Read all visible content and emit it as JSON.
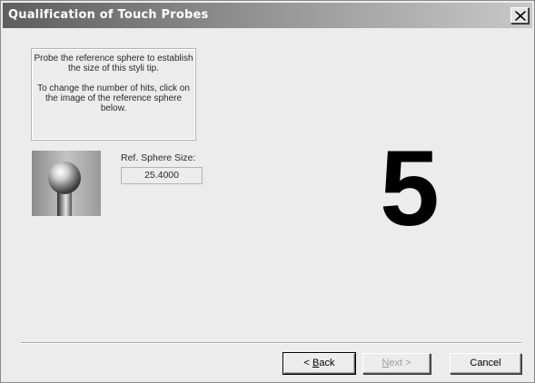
{
  "window": {
    "title": "Qualification of Touch Probes",
    "close_label": "Close"
  },
  "instructions": {
    "line1": "Probe the reference sphere to establish the size of this styli tip.",
    "line2": "To change the number of hits, click on the image of the reference sphere below."
  },
  "reference_sphere": {
    "label": "Ref. Sphere Size:",
    "value": "25.4000"
  },
  "hits_remaining": "5",
  "buttons": {
    "back": "< Back",
    "back_accelerator": "B",
    "next": "Next >",
    "next_accelerator": "N",
    "next_enabled": false,
    "cancel": "Cancel"
  }
}
